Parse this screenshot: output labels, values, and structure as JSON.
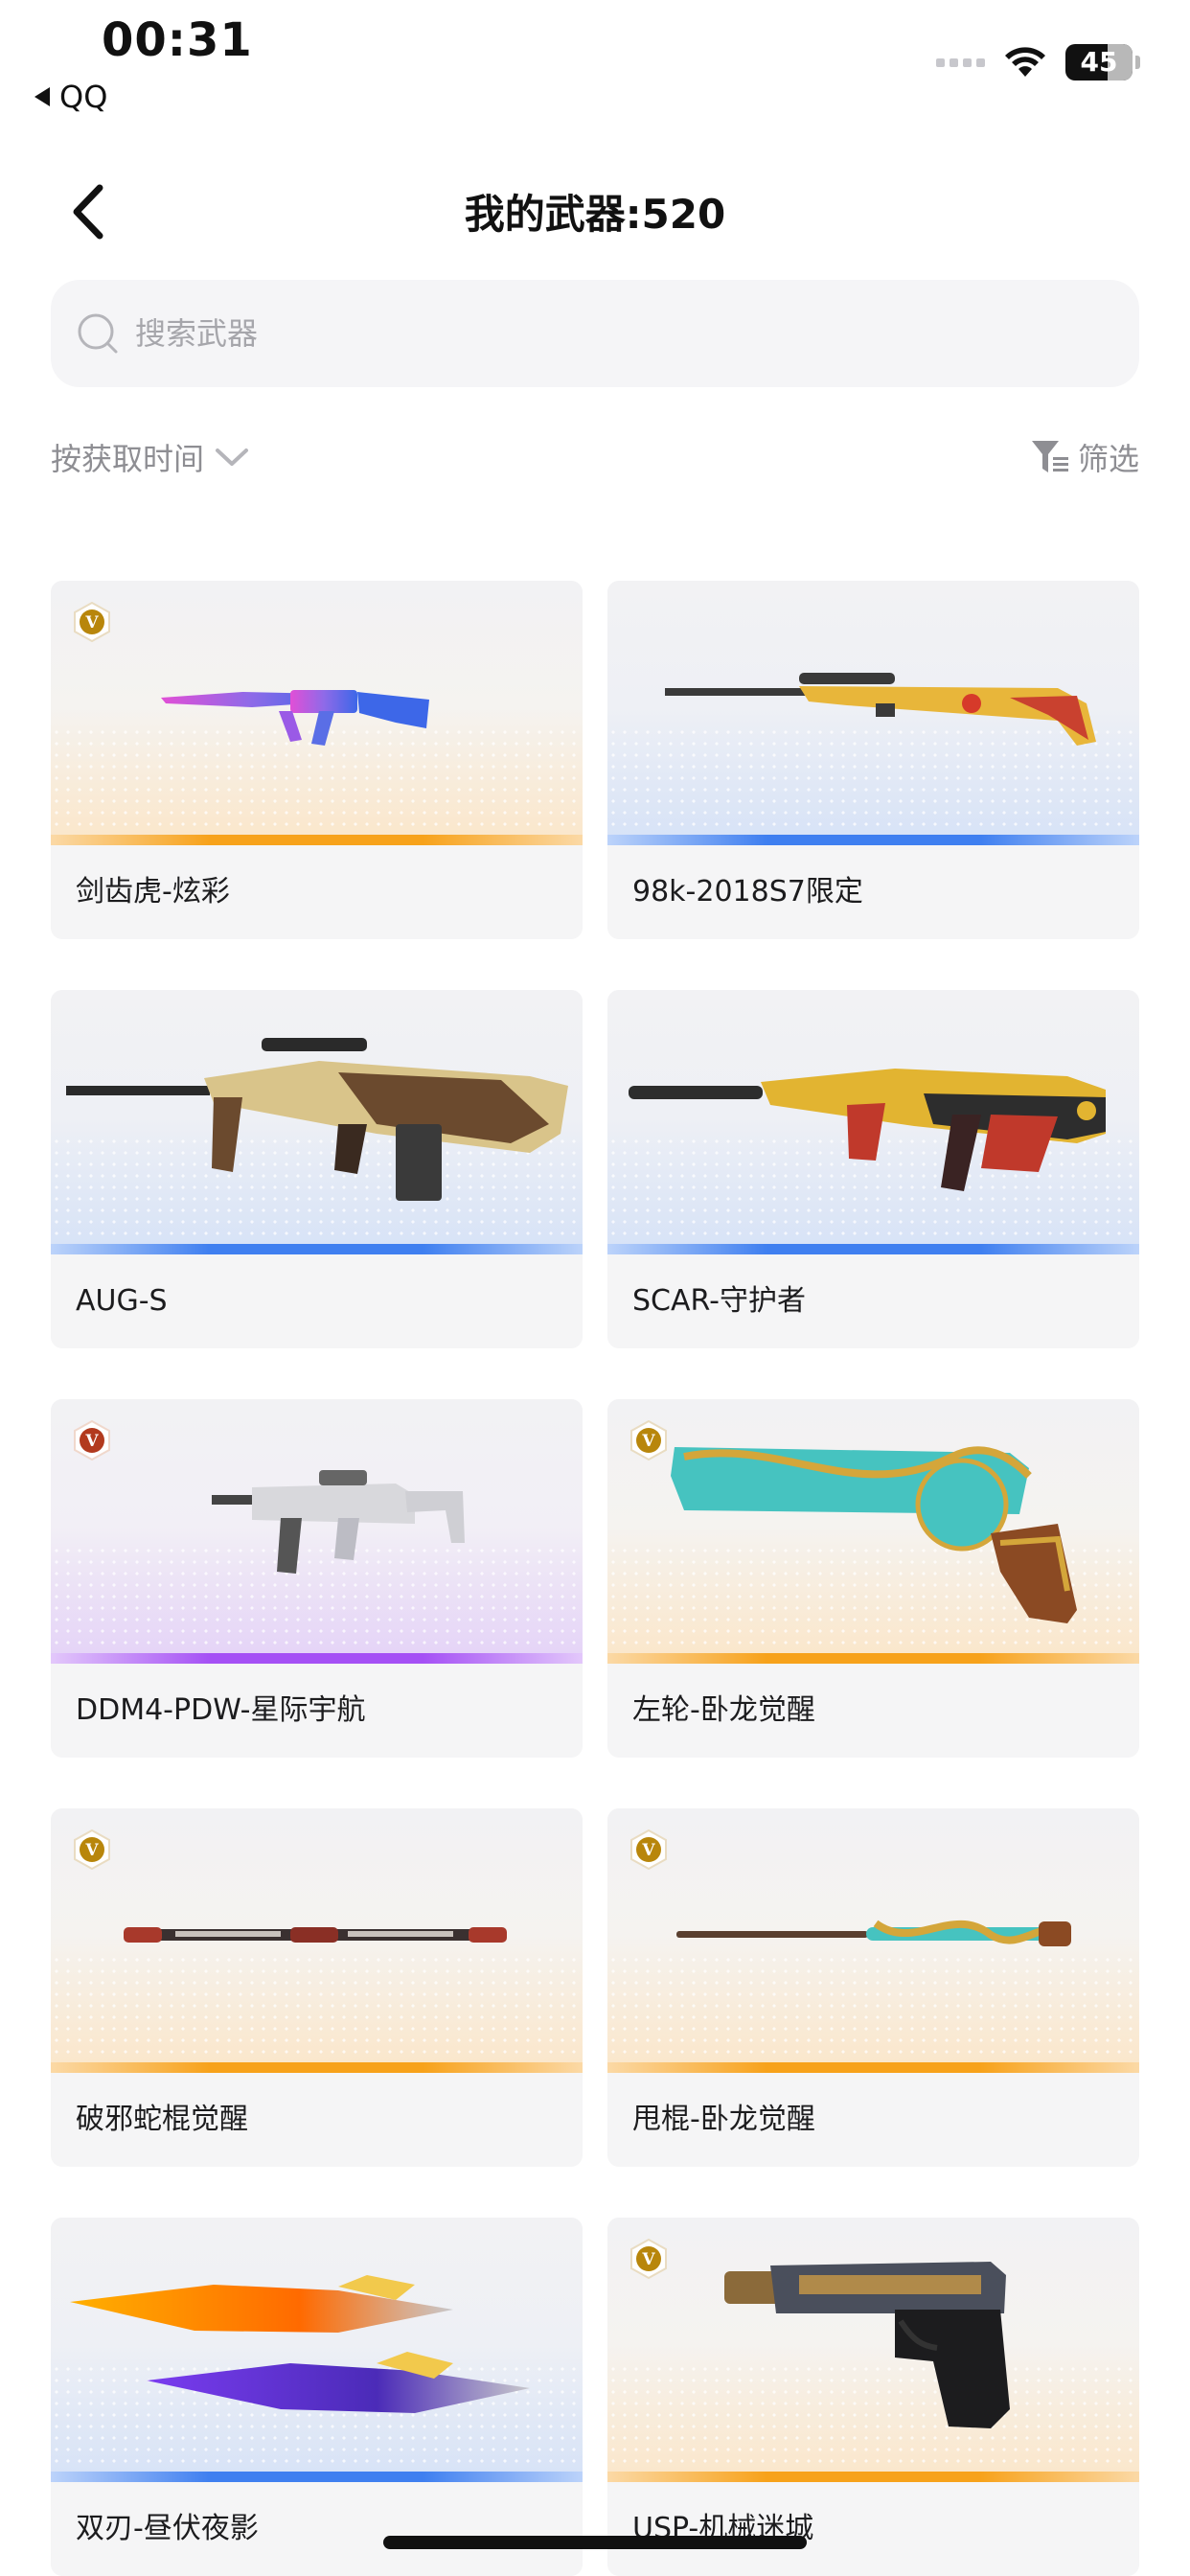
{
  "status_bar": {
    "time": "00:31",
    "back_app": "QQ",
    "battery": "45"
  },
  "header": {
    "title": "我的武器:520"
  },
  "search": {
    "placeholder": "搜索武器"
  },
  "toolbar": {
    "sort_label": "按获取时间",
    "filter_label": "筛选"
  },
  "weapons": [
    {
      "name": "剑齿虎-炫彩",
      "rarity": "orange",
      "badge": "V",
      "badge_color": "gold"
    },
    {
      "name": "98k-2018S7限定",
      "rarity": "blue",
      "badge": "",
      "badge_color": ""
    },
    {
      "name": "AUG-S",
      "rarity": "blue",
      "badge": "",
      "badge_color": ""
    },
    {
      "name": "SCAR-守护者",
      "rarity": "blue",
      "badge": "",
      "badge_color": ""
    },
    {
      "name": "DDM4-PDW-星际宇航",
      "rarity": "purple",
      "badge": "V",
      "badge_color": "red"
    },
    {
      "name": "左轮-卧龙觉醒",
      "rarity": "orange",
      "badge": "V",
      "badge_color": "gold"
    },
    {
      "name": "破邪蛇棍觉醒",
      "rarity": "orange",
      "badge": "V",
      "badge_color": "gold"
    },
    {
      "name": "甩棍-卧龙觉醒",
      "rarity": "orange",
      "badge": "V",
      "badge_color": "gold"
    },
    {
      "name": "双刃-昼伏夜影",
      "rarity": "blue",
      "badge": "",
      "badge_color": ""
    },
    {
      "name": "USP-机械迷城",
      "rarity": "orange",
      "badge": "V",
      "badge_color": "gold"
    }
  ],
  "colors": {
    "orange": "#f7a21b",
    "blue": "#3f7ff0",
    "purple": "#a550f5",
    "badge_gold": "#b8860b",
    "badge_red": "#b23a1e"
  }
}
